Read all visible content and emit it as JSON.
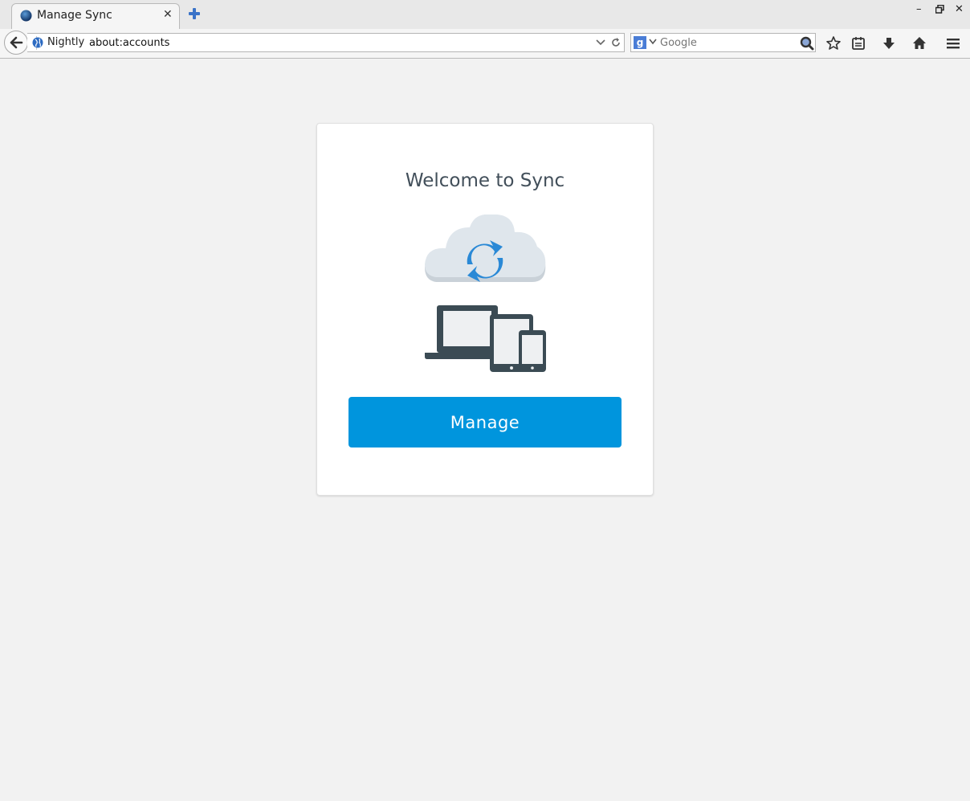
{
  "tab": {
    "title": "Manage Sync",
    "close_label": "✕"
  },
  "window": {
    "minimize": "–",
    "restore": "▫",
    "close": "✕"
  },
  "navbar": {
    "identity_label": "Nightly",
    "url": "about:accounts",
    "search_placeholder": "Google",
    "search_engine_letter": "g"
  },
  "card": {
    "title": "Welcome to Sync",
    "button_label": "Manage"
  },
  "colors": {
    "accent": "#0095dd",
    "title_text": "#424f5a",
    "sync_arrow": "#2a89d6",
    "cloud": "#dfe6ec",
    "device": "#3b4b54"
  }
}
